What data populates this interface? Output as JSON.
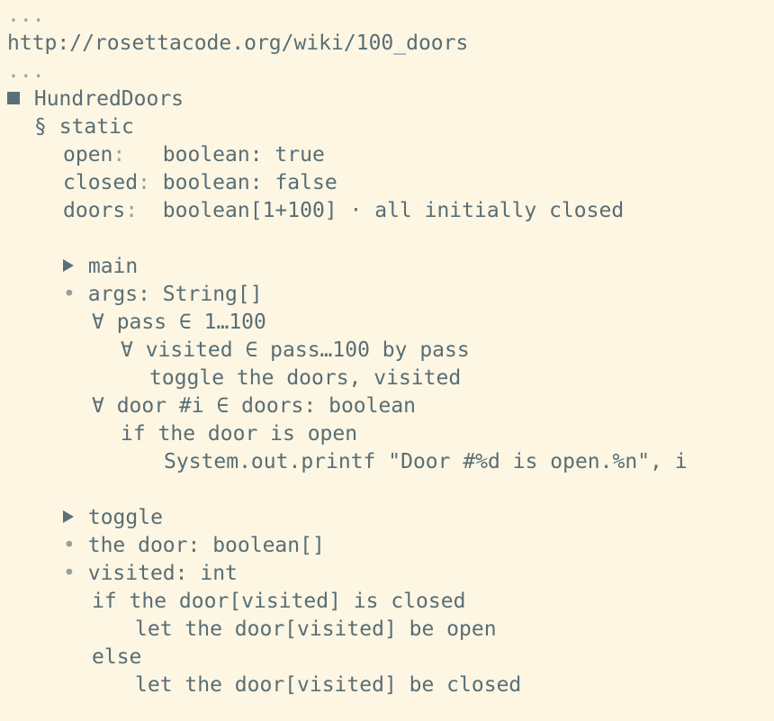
{
  "document": {
    "ellipsis_top": "...",
    "url": "http://rosettacode.org/wiki/100_doors",
    "ellipsis_bottom": "...",
    "class_name": "HundredDoors",
    "section_symbol": "§",
    "section_name": "static",
    "fields": [
      {
        "name": "open",
        "type": "boolean",
        "value": "true"
      },
      {
        "name": "closed",
        "type": "boolean",
        "value": "false"
      },
      {
        "name": "doors",
        "type": "boolean[1+100]",
        "comment": "· all initially closed"
      }
    ]
  },
  "methods": {
    "main": {
      "name": "main",
      "param": "args: String[]",
      "loop_pass": "∀ pass ∈ 1…100",
      "loop_visited": "∀ visited ∈ pass…100 by pass",
      "toggle_call": "toggle the doors, visited",
      "loop_door": "∀ door #i ∈ doors: boolean",
      "if_open": "if the door is open",
      "print": "System.out.printf \"Door #%d is open.%n\", i"
    },
    "toggle": {
      "name": "toggle",
      "param_door": "the door: boolean[]",
      "param_visited": "visited: int",
      "if_closed": "if the door[visited] is closed",
      "set_open": "let the door[visited] be open",
      "else": "else",
      "set_closed": "let the door[visited] be closed"
    }
  }
}
